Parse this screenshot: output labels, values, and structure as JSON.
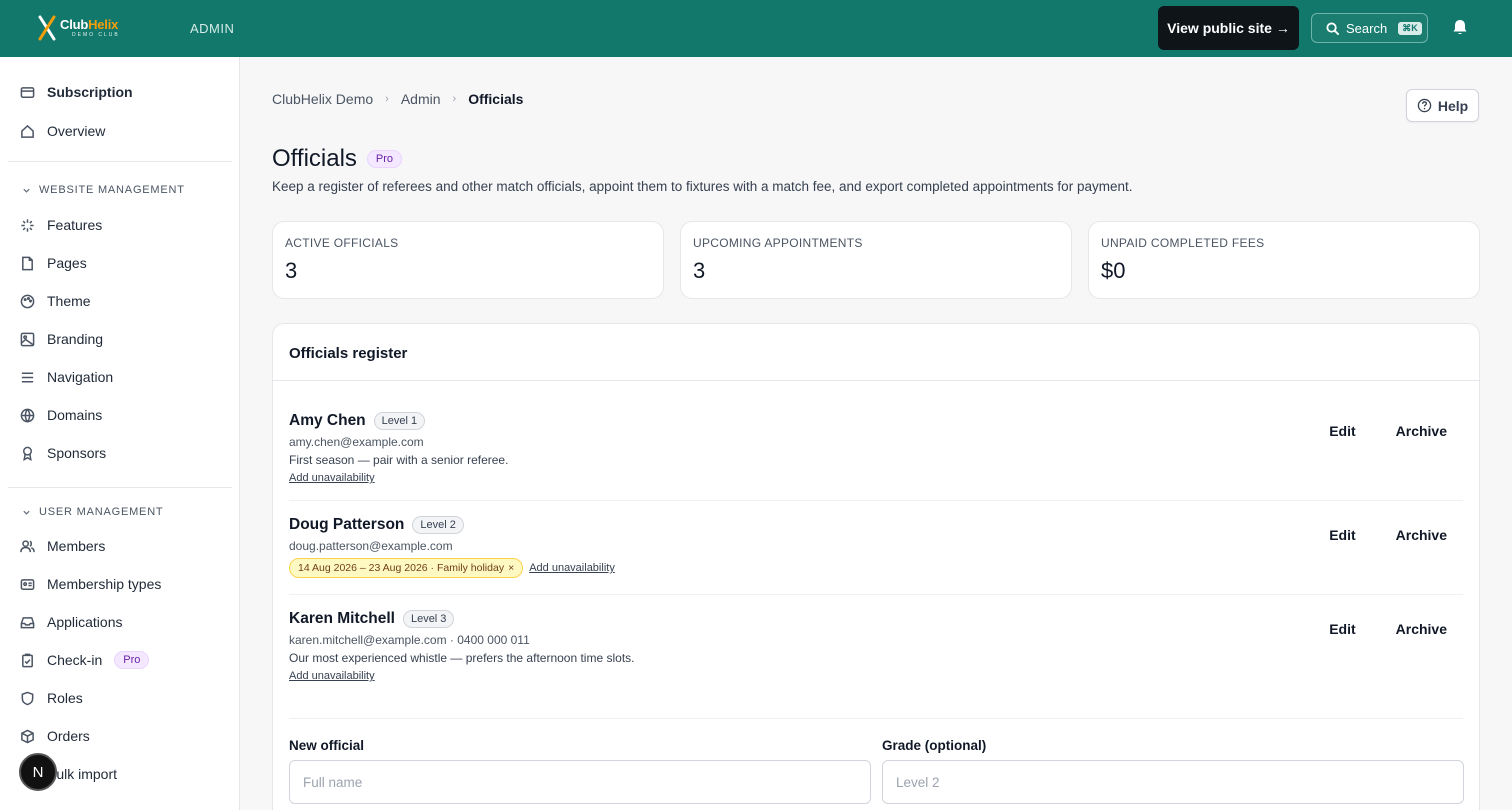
{
  "header": {
    "logo_name_club": "Club",
    "logo_name_helix": "Helix",
    "logo_sub": "DEMO CLUB",
    "section_label": "ADMIN",
    "view_public_label": "View public site →",
    "search_label": "Search",
    "search_shortcut": "⌘K",
    "accent_color": "#12786b"
  },
  "sidebar": {
    "top_items": [
      {
        "label": "Subscription",
        "icon": "credit-card-icon"
      },
      {
        "label": "Overview",
        "icon": "home-icon"
      }
    ],
    "website_section": "WEBSITE MANAGEMENT",
    "website_items": [
      {
        "label": "Features",
        "icon": "sparkle-icon"
      },
      {
        "label": "Pages",
        "icon": "file-icon"
      },
      {
        "label": "Theme",
        "icon": "palette-icon"
      },
      {
        "label": "Branding",
        "icon": "image-icon"
      },
      {
        "label": "Navigation",
        "icon": "menu-icon"
      },
      {
        "label": "Domains",
        "icon": "globe-icon"
      },
      {
        "label": "Sponsors",
        "icon": "ribbon-icon"
      }
    ],
    "user_section": "USER MANAGEMENT",
    "user_items": [
      {
        "label": "Members",
        "icon": "users-icon"
      },
      {
        "label": "Membership types",
        "icon": "id-card-icon"
      },
      {
        "label": "Applications",
        "icon": "inbox-icon"
      },
      {
        "label": "Check-in",
        "icon": "clipboard-check-icon",
        "badge": "Pro"
      },
      {
        "label": "Roles",
        "icon": "shield-icon"
      },
      {
        "label": "Orders",
        "icon": "box-icon"
      },
      {
        "label": "Bulk import",
        "icon": "upload-icon"
      }
    ],
    "avatar_letter": "N"
  },
  "breadcrumb": [
    "ClubHelix Demo",
    "Admin",
    "Officials"
  ],
  "help_label": "Help",
  "page": {
    "title": "Officials",
    "badge": "Pro",
    "description": "Keep a register of referees and other match officials, appoint them to fixtures with a match fee, and export completed appointments for payment."
  },
  "stats": [
    {
      "label": "ACTIVE OFFICIALS",
      "value": "3"
    },
    {
      "label": "UPCOMING APPOINTMENTS",
      "value": "3"
    },
    {
      "label": "UNPAID COMPLETED FEES",
      "value": "$0"
    }
  ],
  "register": {
    "title": "Officials register",
    "edit_label": "Edit",
    "archive_label": "Archive",
    "add_unavailability_label": "Add unavailability",
    "officials": [
      {
        "name": "Amy Chen",
        "level": "Level 1",
        "contact": "amy.chen@example.com",
        "note": "First season — pair with a senior referee."
      },
      {
        "name": "Doug Patterson",
        "level": "Level 2",
        "contact": "doug.patterson@example.com",
        "unavailability": "14 Aug 2026 – 23 Aug 2026 · Family holiday",
        "remove_symbol": "×"
      },
      {
        "name": "Karen Mitchell",
        "level": "Level 3",
        "contact": "karen.mitchell@example.com · 0400 000 011",
        "note": "Our most experienced whistle — prefers the afternoon time slots."
      }
    ]
  },
  "form": {
    "name_label": "New official",
    "name_placeholder": "Full name",
    "grade_label": "Grade (optional)",
    "grade_placeholder": "Level 2"
  }
}
